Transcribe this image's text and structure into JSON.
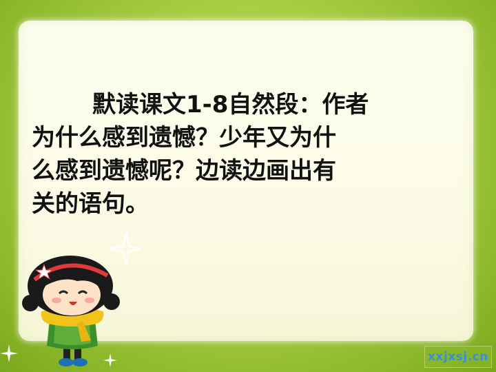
{
  "slide": {
    "text_lines": [
      "默读课文1-8自然段：作者",
      "为什么感到遗憾？少年又为什",
      "么感到遗憾呢？边读边画出有",
      "关的语句。"
    ]
  },
  "watermark": {
    "text": "xxjxsj.cn"
  },
  "colors": {
    "background_green": "#a9cd45",
    "panel_cream": "#fbfbe6",
    "text": "#111111",
    "watermark_text": "#3b8fd6"
  }
}
